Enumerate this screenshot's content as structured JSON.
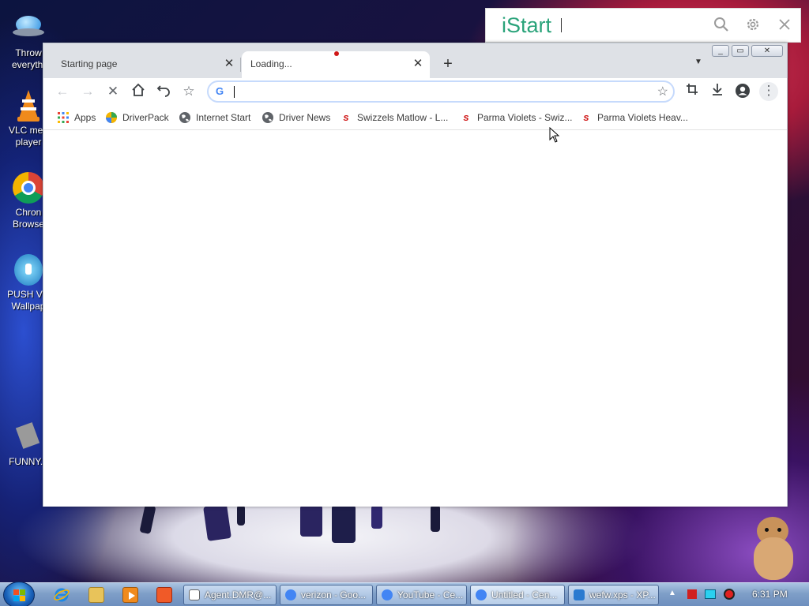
{
  "desktop": {
    "icons": [
      {
        "label": "Throw everythi"
      },
      {
        "label": "VLC med player"
      },
      {
        "label": "Chron Browse"
      },
      {
        "label": "PUSH Vid Wallpap"
      },
      {
        "label": "FUNNY..."
      }
    ]
  },
  "istart": {
    "logo": "iStart",
    "icons": [
      "search-icon",
      "gear-icon",
      "close-icon"
    ]
  },
  "browser": {
    "tabs": [
      {
        "label": "Starting page",
        "active": false
      },
      {
        "label": "Loading...",
        "active": true
      }
    ],
    "window_buttons": [
      "minimize",
      "restore",
      "close"
    ],
    "omnibox": {
      "value": "",
      "placeholder": ""
    },
    "bookmarks": [
      {
        "label": "Apps",
        "icon": "apps-grid-icon"
      },
      {
        "label": "DriverPack",
        "icon": "driverpack-icon"
      },
      {
        "label": "Internet Start",
        "icon": "globe-icon"
      },
      {
        "label": "Driver News",
        "icon": "globe-icon"
      },
      {
        "label": "Swizzels Matlow - L...",
        "icon": "swizzels-icon"
      },
      {
        "label": "Parma Violets - Swiz...",
        "icon": "swizzels-icon"
      },
      {
        "label": "Parma Violets Heav...",
        "icon": "swizzels-icon"
      }
    ]
  },
  "taskbar": {
    "tasks": [
      {
        "label": "Agent.DMR@..."
      },
      {
        "label": "verizon - Goo..."
      },
      {
        "label": "YouTube - Ce..."
      },
      {
        "label": "Untitled - Cen..."
      },
      {
        "label": "wefw.xps - XP..."
      }
    ],
    "clock": "6:31 PM"
  },
  "colors": {
    "istart_green": "#2aa37a",
    "loading_dot": "#d01818",
    "tab_strip": "#dee1e6",
    "omnibox_border": "#c6dafc"
  }
}
